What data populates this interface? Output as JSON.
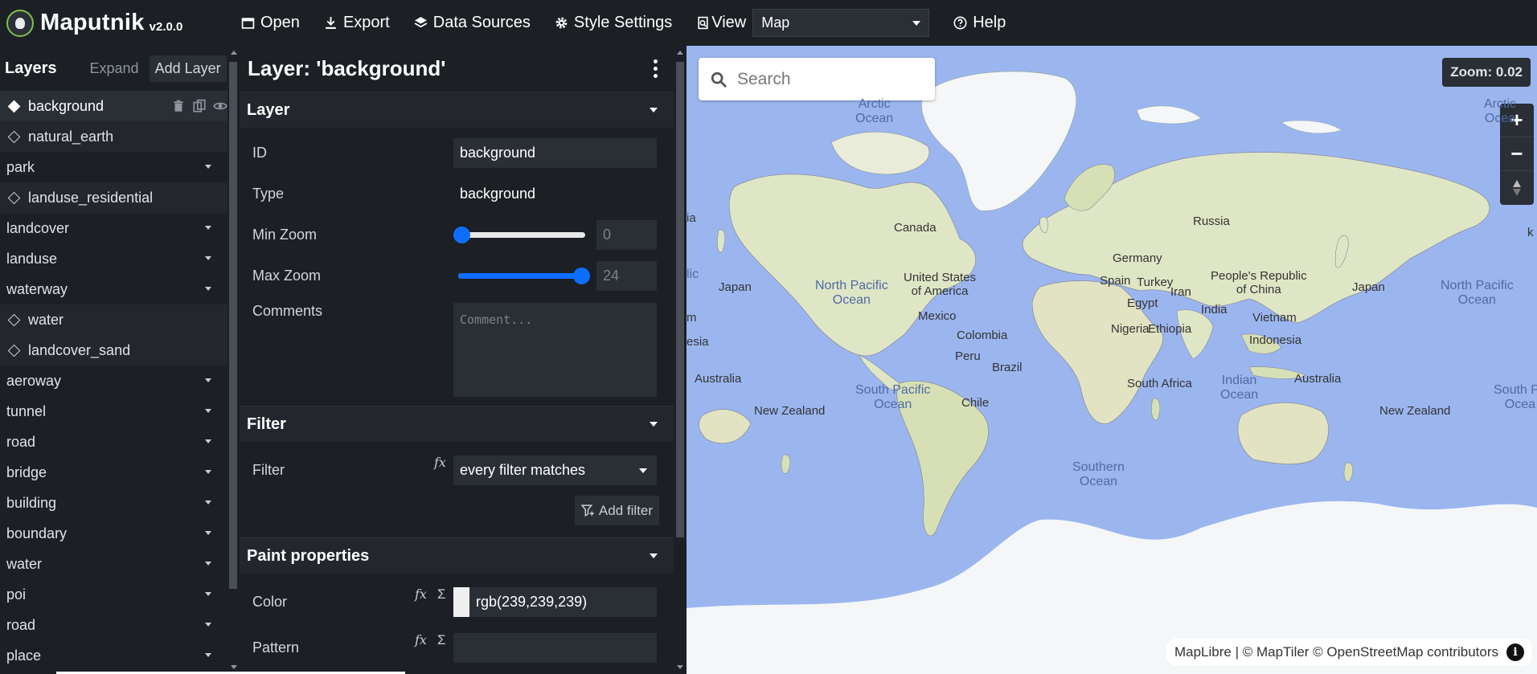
{
  "app": {
    "name": "Maputnik",
    "version": "v2.0.0"
  },
  "toolbar": {
    "open": "Open",
    "export": "Export",
    "data_sources": "Data Sources",
    "style_settings": "Style Settings",
    "view": "View",
    "view_value": "Map",
    "help": "Help"
  },
  "layers_panel": {
    "title": "Layers",
    "expand": "Expand",
    "add_layer": "Add Layer",
    "items": [
      {
        "label": "background",
        "kind": "layer",
        "selected": true
      },
      {
        "label": "natural_earth",
        "kind": "layer"
      },
      {
        "label": "park",
        "kind": "group"
      },
      {
        "label": "landuse_residential",
        "kind": "layer"
      },
      {
        "label": "landcover",
        "kind": "group"
      },
      {
        "label": "landuse",
        "kind": "group"
      },
      {
        "label": "waterway",
        "kind": "group"
      },
      {
        "label": "water",
        "kind": "layer"
      },
      {
        "label": "landcover_sand",
        "kind": "layer"
      },
      {
        "label": "aeroway",
        "kind": "group"
      },
      {
        "label": "tunnel",
        "kind": "group"
      },
      {
        "label": "road",
        "kind": "group"
      },
      {
        "label": "bridge",
        "kind": "group"
      },
      {
        "label": "building",
        "kind": "group"
      },
      {
        "label": "boundary",
        "kind": "group"
      },
      {
        "label": "water",
        "kind": "group"
      },
      {
        "label": "poi",
        "kind": "group"
      },
      {
        "label": "road",
        "kind": "group"
      },
      {
        "label": "place",
        "kind": "group"
      }
    ]
  },
  "editor": {
    "title": "Layer: 'background'",
    "layer_section": {
      "heading": "Layer",
      "id_label": "ID",
      "id_value": "background",
      "type_label": "Type",
      "type_value": "background",
      "min_zoom_label": "Min Zoom",
      "min_zoom_value": "0",
      "min_zoom_level": 0,
      "max_zoom_label": "Max Zoom",
      "max_zoom_value": "24",
      "max_zoom_level": 24,
      "comments_label": "Comments",
      "comments_placeholder": "Comment..."
    },
    "filter_section": {
      "heading": "Filter",
      "filter_label": "Filter",
      "filter_value": "every filter matches",
      "add_filter": "Add filter"
    },
    "paint_section": {
      "heading": "Paint properties",
      "color_label": "Color",
      "color_value": "rgb(239,239,239)",
      "pattern_label": "Pattern"
    }
  },
  "map": {
    "search_placeholder": "Search",
    "zoom_badge": "Zoom: 0.02",
    "attribution": "MapLibre | © MapTiler © OpenStreetMap contributors",
    "labels": {
      "arctic": "Arctic\nOcean",
      "arctic2": "Arctic\nOcea",
      "canada": "Canada",
      "us": "United States\nof America",
      "mexico": "Mexico",
      "npo": "North Pacific\nOcean",
      "npo2": "North Pacific\nOcean",
      "japan": "Japan",
      "japan2": "Japan",
      "colombia": "Colombia",
      "peru": "Peru",
      "brazil": "Brazil",
      "chile": "Chile",
      "spo": "South Pacific\nOcean",
      "spo2": "South Pa\nOcea",
      "russia": "Russia",
      "germany": "Germany",
      "spain": "Spain",
      "turkey": "Turkey",
      "iran": "Iran",
      "egypt": "Egypt",
      "china": "People's Republic\nof China",
      "india": "India",
      "vietnam": "Vietnam",
      "nigeria": "Nigeria",
      "ethiopia": "Ethiopia",
      "indonesia": "Indonesia",
      "south_africa": "South Africa",
      "indian_ocean": "Indian\nOcean",
      "australia": "Australia",
      "australia2": "Australia",
      "new_zealand": "New Zealand",
      "new_zealand2": "New Zealand",
      "southern_ocean": "Southern\nOcean",
      "ia": "ia",
      "lic": "lic",
      "m": "m",
      "esia": "esia",
      "k": "k"
    }
  },
  "colors": {
    "ocean": "#9bb6ef",
    "land": "#dfe6c6",
    "ice": "#f4f6f8",
    "panel": "#1c1f24",
    "accent": "#0d6efd"
  }
}
